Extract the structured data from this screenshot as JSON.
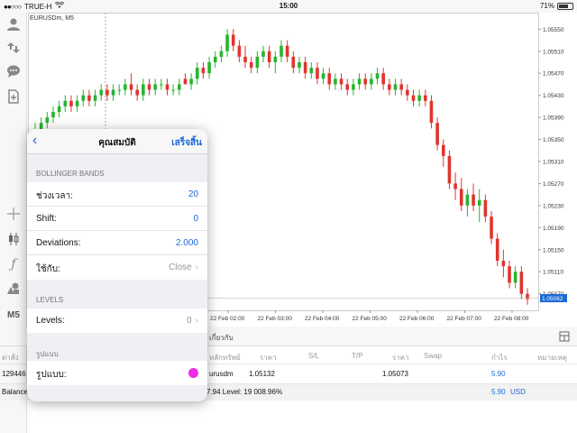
{
  "status_bar": {
    "carrier": "TRUE-H",
    "time": "15:00",
    "battery": "71%",
    "battery_level": 0.71
  },
  "toolbar": {
    "icons": [
      "user-icon",
      "trade-arrows-icon",
      "chat-icon",
      "document-plus-icon",
      "crosshair-icon",
      "candles-icon",
      "function-icon",
      "objects-icon",
      "timeframe",
      "plus-icon"
    ],
    "timeframe_label": "M5"
  },
  "chart": {
    "symbol_label": "EURUSDm, M5",
    "current_price": "1.05062",
    "price_ticks": [
      "1.05550",
      "1.05510",
      "1.05470",
      "1.05430",
      "1.05390",
      "1.05350",
      "1.05310",
      "1.05270",
      "1.05230",
      "1.05190",
      "1.05150",
      "1.05110",
      "1.05070"
    ],
    "time_ticks": [
      "22 Feb 02:00",
      "22 Feb 03:00",
      "22 Feb 04:00",
      "22 Feb 05:00",
      "22 Feb 06:00",
      "22 Feb 07:00",
      "22 Feb 08:00"
    ],
    "colors": {
      "bull": "#27b52d",
      "bear": "#e0352e",
      "grid": "#ececec",
      "price_tag": "#1a6ad6"
    }
  },
  "chart_data": {
    "type": "candlestick",
    "x": "bar index (5-minute bars, 22 Feb)",
    "ylim": [
      1.0504,
      1.0558
    ],
    "candles": [
      [
        1.0536,
        1.0538,
        1.0534,
        1.0536
      ],
      [
        1.0536,
        1.0539,
        1.0535,
        1.0538
      ],
      [
        1.0538,
        1.054,
        1.0537,
        1.0539
      ],
      [
        1.0539,
        1.0541,
        1.0538,
        1.054
      ],
      [
        1.054,
        1.0542,
        1.0539,
        1.0541
      ],
      [
        1.0541,
        1.0543,
        1.054,
        1.0542
      ],
      [
        1.0542,
        1.0543,
        1.054,
        1.0541
      ],
      [
        1.0541,
        1.0543,
        1.054,
        1.0542
      ],
      [
        1.0542,
        1.0544,
        1.0541,
        1.0543
      ],
      [
        1.0543,
        1.0544,
        1.0541,
        1.0542
      ],
      [
        1.0542,
        1.0544,
        1.0541,
        1.0543
      ],
      [
        1.0543,
        1.0545,
        1.0542,
        1.0544
      ],
      [
        1.0544,
        1.0545,
        1.0542,
        1.0543
      ],
      [
        1.0543,
        1.0545,
        1.0542,
        1.0544
      ],
      [
        1.0544,
        1.0545,
        1.0543,
        1.0544
      ],
      [
        1.0544,
        1.0546,
        1.0543,
        1.0545
      ],
      [
        1.0545,
        1.0547,
        1.0543,
        1.0544
      ],
      [
        1.0544,
        1.0545,
        1.0542,
        1.0543
      ],
      [
        1.0543,
        1.0546,
        1.0542,
        1.0545
      ],
      [
        1.0545,
        1.0546,
        1.0543,
        1.0544
      ],
      [
        1.0544,
        1.0546,
        1.0543,
        1.0545
      ],
      [
        1.0545,
        1.0546,
        1.0544,
        1.0545
      ],
      [
        1.0545,
        1.0546,
        1.0543,
        1.0544
      ],
      [
        1.0544,
        1.0545,
        1.0543,
        1.0544
      ],
      [
        1.0544,
        1.0546,
        1.0543,
        1.0545
      ],
      [
        1.0546,
        1.0547,
        1.0545,
        1.0545
      ],
      [
        1.0545,
        1.0547,
        1.0544,
        1.0546
      ],
      [
        1.0546,
        1.0549,
        1.0545,
        1.0548
      ],
      [
        1.0548,
        1.0549,
        1.0546,
        1.0547
      ],
      [
        1.0547,
        1.055,
        1.0546,
        1.0549
      ],
      [
        1.0549,
        1.0551,
        1.0548,
        1.055
      ],
      [
        1.055,
        1.0552,
        1.0549,
        1.0551
      ],
      [
        1.0551,
        1.0555,
        1.055,
        1.0554
      ],
      [
        1.0554,
        1.0555,
        1.0551,
        1.0552
      ],
      [
        1.0552,
        1.0553,
        1.0549,
        1.055
      ],
      [
        1.055,
        1.0552,
        1.0548,
        1.0549
      ],
      [
        1.0549,
        1.055,
        1.0547,
        1.0548
      ],
      [
        1.0548,
        1.0551,
        1.0547,
        1.055
      ],
      [
        1.055,
        1.0552,
        1.0549,
        1.0551
      ],
      [
        1.0551,
        1.0552,
        1.0548,
        1.0549
      ],
      [
        1.0549,
        1.0551,
        1.0547,
        1.055
      ],
      [
        1.055,
        1.0553,
        1.0549,
        1.0552
      ],
      [
        1.0552,
        1.0553,
        1.0549,
        1.055
      ],
      [
        1.055,
        1.0551,
        1.0547,
        1.0548
      ],
      [
        1.0548,
        1.055,
        1.0547,
        1.0549
      ],
      [
        1.0549,
        1.055,
        1.0546,
        1.0547
      ],
      [
        1.0547,
        1.0549,
        1.0546,
        1.0548
      ],
      [
        1.0548,
        1.0549,
        1.0545,
        1.0546
      ],
      [
        1.0546,
        1.0548,
        1.0545,
        1.0547
      ],
      [
        1.0547,
        1.0548,
        1.0544,
        1.0545
      ],
      [
        1.0545,
        1.0547,
        1.0544,
        1.0546
      ],
      [
        1.0546,
        1.0547,
        1.0544,
        1.0545
      ],
      [
        1.0545,
        1.0546,
        1.0543,
        1.0544
      ],
      [
        1.0544,
        1.0546,
        1.0543,
        1.0545
      ],
      [
        1.0545,
        1.0547,
        1.0544,
        1.0546
      ],
      [
        1.0546,
        1.0547,
        1.0544,
        1.0545
      ],
      [
        1.0545,
        1.0547,
        1.0544,
        1.0546
      ],
      [
        1.0546,
        1.0548,
        1.0545,
        1.0547
      ],
      [
        1.0547,
        1.0548,
        1.0544,
        1.0545
      ],
      [
        1.0545,
        1.0546,
        1.0543,
        1.0544
      ],
      [
        1.0544,
        1.0546,
        1.0543,
        1.0545
      ],
      [
        1.0545,
        1.0546,
        1.0543,
        1.0544
      ],
      [
        1.0544,
        1.0545,
        1.0542,
        1.0543
      ],
      [
        1.0543,
        1.0544,
        1.0541,
        1.0542
      ],
      [
        1.0542,
        1.0544,
        1.0541,
        1.0543
      ],
      [
        1.0543,
        1.0544,
        1.0541,
        1.0542
      ],
      [
        1.0542,
        1.0543,
        1.0537,
        1.0538
      ],
      [
        1.0538,
        1.0539,
        1.0533,
        1.0534
      ],
      [
        1.0534,
        1.0535,
        1.053,
        1.0532
      ],
      [
        1.0532,
        1.0533,
        1.0526,
        1.0527
      ],
      [
        1.0527,
        1.0529,
        1.0524,
        1.0526
      ],
      [
        1.0526,
        1.0528,
        1.0522,
        1.0523
      ],
      [
        1.0523,
        1.0526,
        1.0521,
        1.0525
      ],
      [
        1.0525,
        1.0527,
        1.0522,
        1.0523
      ],
      [
        1.0523,
        1.0526,
        1.052,
        1.0524
      ],
      [
        1.0524,
        1.0525,
        1.052,
        1.0521
      ],
      [
        1.0521,
        1.0522,
        1.0516,
        1.0517
      ],
      [
        1.0517,
        1.0518,
        1.0512,
        1.0513
      ],
      [
        1.0513,
        1.0515,
        1.051,
        1.0512
      ],
      [
        1.0512,
        1.0513,
        1.0508,
        1.0509
      ],
      [
        1.0509,
        1.0512,
        1.0508,
        1.0511
      ],
      [
        1.0511,
        1.0512,
        1.0506,
        1.0507
      ],
      [
        1.0507,
        1.0508,
        1.0505,
        1.0506
      ]
    ]
  },
  "popover": {
    "title": "คุณสมบัติ",
    "done_label": "เสร็จสิ้น",
    "sections": {
      "bollinger": "BOLLINGER BANDS",
      "levels": "LEVELS",
      "style": "รูปแบบ"
    },
    "bollinger_rows": [
      {
        "label": "ช่วงเวลา:",
        "value": "20"
      },
      {
        "label": "Shift:",
        "value": "0"
      },
      {
        "label": "Deviations:",
        "value": "2.000"
      },
      {
        "label": "ใช้กับ:",
        "value": "Close"
      }
    ],
    "levels_row": {
      "label": "Levels:",
      "value": "0"
    },
    "style_row": {
      "label": "รูปแบบ:",
      "color": "#ee2be6"
    }
  },
  "trades": {
    "tab_fragment": "เกี่ยวกับ",
    "headers": {
      "col1": "ต่าสั่ง",
      "col2": "หลักทรัพย์",
      "col3": "ราคา",
      "col4": "S/L",
      "col5": "T/P",
      "col6": "ราคา",
      "col7": "Swap",
      "col8": "กำไร",
      "col9": "หมายเหตุ"
    },
    "row": {
      "ticket": "129446",
      "symbol": "urusdm",
      "open_price": "1.05132",
      "current_price": "1.05073",
      "profit": "5.90"
    },
    "balance": {
      "label": "Balance",
      "level_text": "7.94 Level: 19 008.96%",
      "profit": "5.90",
      "currency": "USD"
    }
  }
}
